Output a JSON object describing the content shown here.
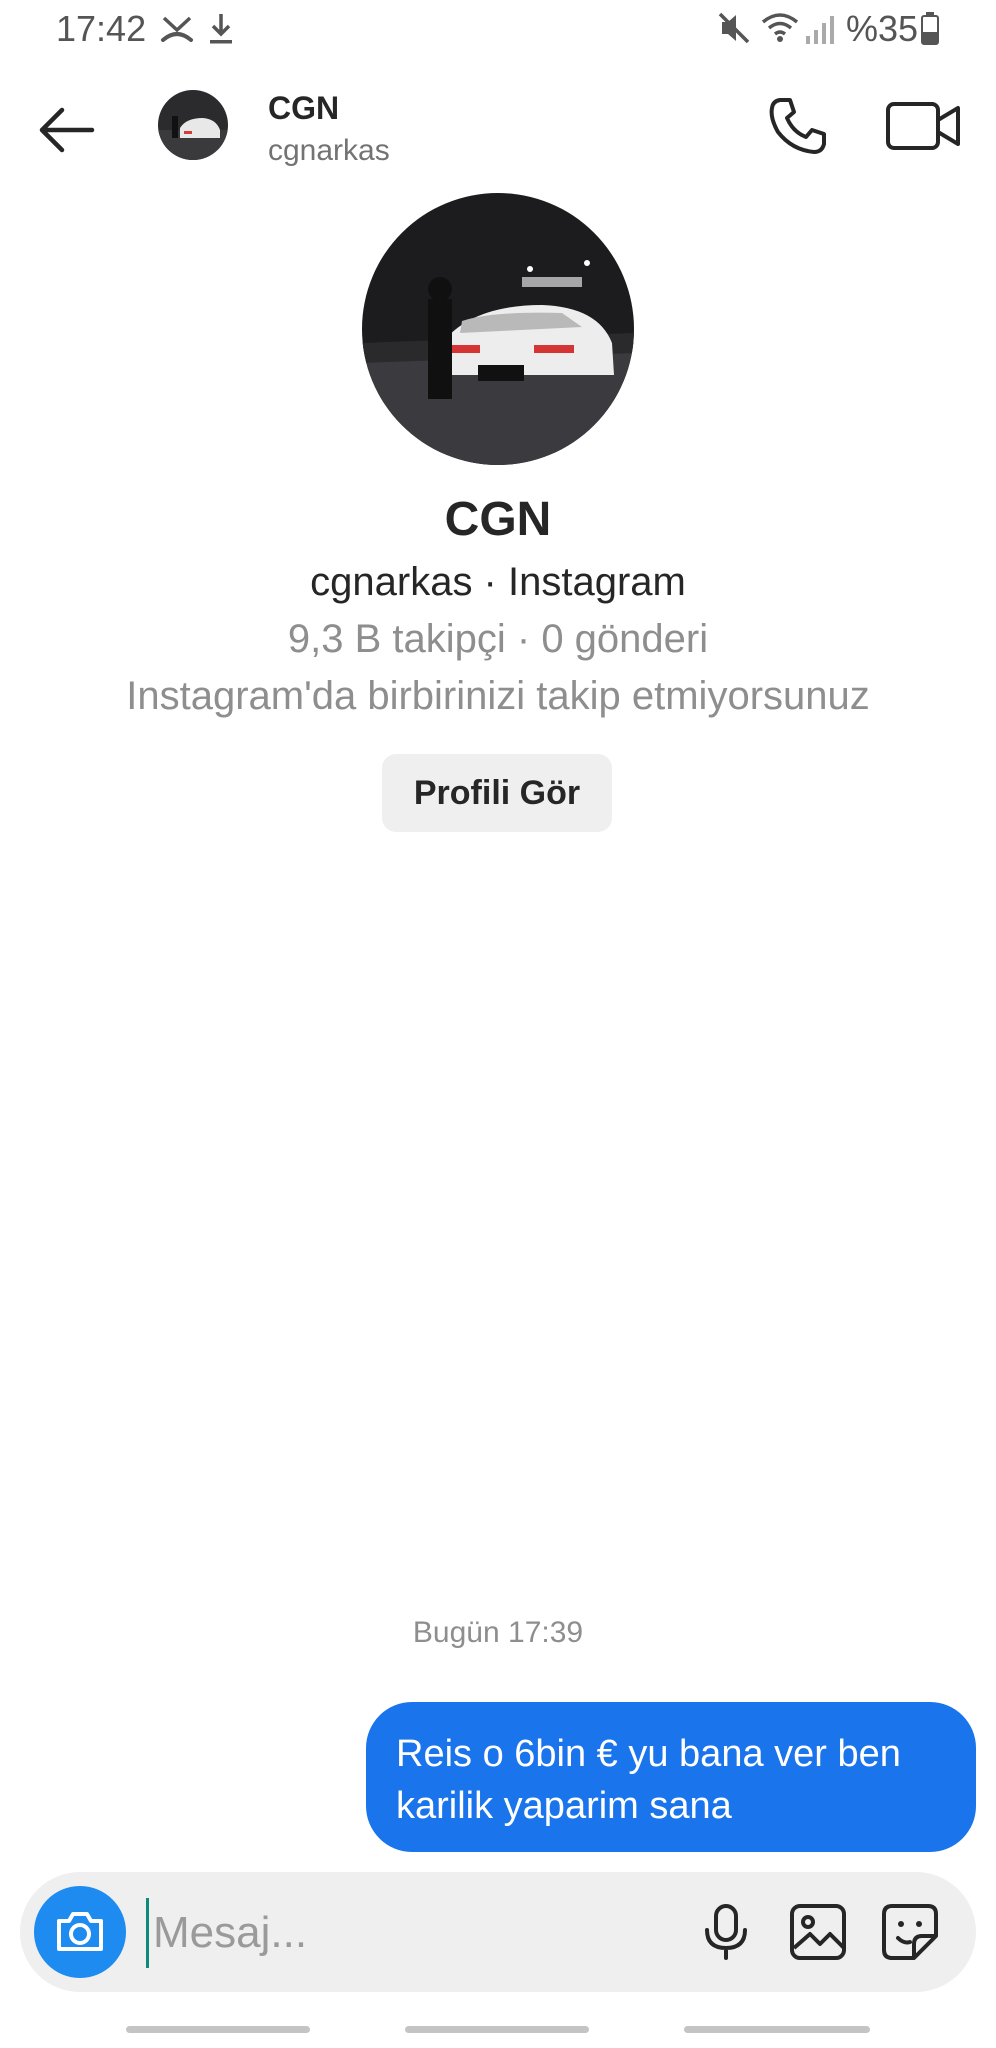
{
  "status_bar": {
    "time": "17:42",
    "battery": "%35",
    "icons": [
      "missed-call-icon",
      "download-icon",
      "mute-icon",
      "wifi-icon",
      "signal-icon",
      "battery-icon"
    ]
  },
  "header": {
    "name": "CGN",
    "username": "cgnarkas",
    "icons": [
      "back-arrow-icon",
      "phone-icon",
      "video-camera-icon"
    ]
  },
  "profile": {
    "name": "CGN",
    "subtitle": "cgnarkas · Instagram",
    "stats": "9,3 B takipçi · 0 gönderi",
    "follow_status": "Instagram'da birbirinizi takip etmiyorsunuz",
    "view_profile_label": "Profili Gör"
  },
  "messages": {
    "timestamp": "Bugün 17:39",
    "items": [
      {
        "text": "Reis o 6bin € yu bana ver ben karilik yaparim sana",
        "sender": "me"
      }
    ]
  },
  "composer": {
    "placeholder": "Mesaj...",
    "icons": [
      "camera-icon",
      "microphone-icon",
      "gallery-icon",
      "sticker-icon"
    ]
  },
  "colors": {
    "accent_blue": "#1a74ec",
    "camera_blue": "#1d8bf0",
    "secondary_text": "#8e8e8e",
    "button_bg": "#efefef"
  }
}
